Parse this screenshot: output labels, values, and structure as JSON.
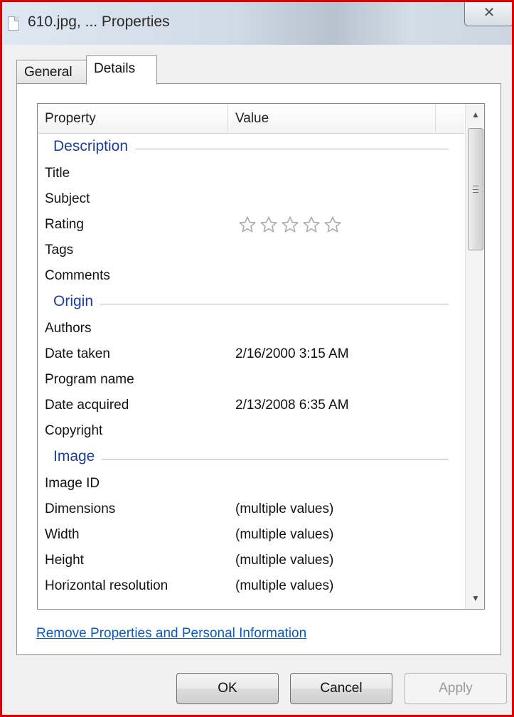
{
  "window": {
    "title": "610.jpg, ... Properties",
    "close_label": "✕"
  },
  "tabs": [
    {
      "label": "General",
      "active": false
    },
    {
      "label": "Details",
      "active": true
    }
  ],
  "list": {
    "columns": {
      "property": "Property",
      "value": "Value"
    },
    "groups": [
      {
        "label": "Description",
        "rows": [
          {
            "name": "Title",
            "value": ""
          },
          {
            "name": "Subject",
            "value": ""
          },
          {
            "name": "Rating",
            "value": "",
            "stars": 0,
            "stars_max": 5
          },
          {
            "name": "Tags",
            "value": ""
          },
          {
            "name": "Comments",
            "value": ""
          }
        ]
      },
      {
        "label": "Origin",
        "rows": [
          {
            "name": "Authors",
            "value": ""
          },
          {
            "name": "Date taken",
            "value": "2/16/2000 3:15 AM"
          },
          {
            "name": "Program name",
            "value": ""
          },
          {
            "name": "Date acquired",
            "value": "2/13/2008 6:35 AM"
          },
          {
            "name": "Copyright",
            "value": ""
          }
        ]
      },
      {
        "label": "Image",
        "rows": [
          {
            "name": "Image ID",
            "value": ""
          },
          {
            "name": "Dimensions",
            "value": "(multiple values)"
          },
          {
            "name": "Width",
            "value": "(multiple values)"
          },
          {
            "name": "Height",
            "value": "(multiple values)"
          },
          {
            "name": "Horizontal resolution",
            "value": "(multiple values)"
          }
        ]
      }
    ]
  },
  "scrollbar": {
    "up_icon": "scroll-up-arrow",
    "down_icon": "scroll-down-arrow",
    "position": 0.0
  },
  "link": {
    "remove_properties": "Remove Properties and Personal Information"
  },
  "buttons": {
    "ok": "OK",
    "cancel": "Cancel",
    "apply": "Apply"
  },
  "colors": {
    "accent": "#1e3e9c",
    "link": "#0a5bbf",
    "frame": "#e00000"
  }
}
